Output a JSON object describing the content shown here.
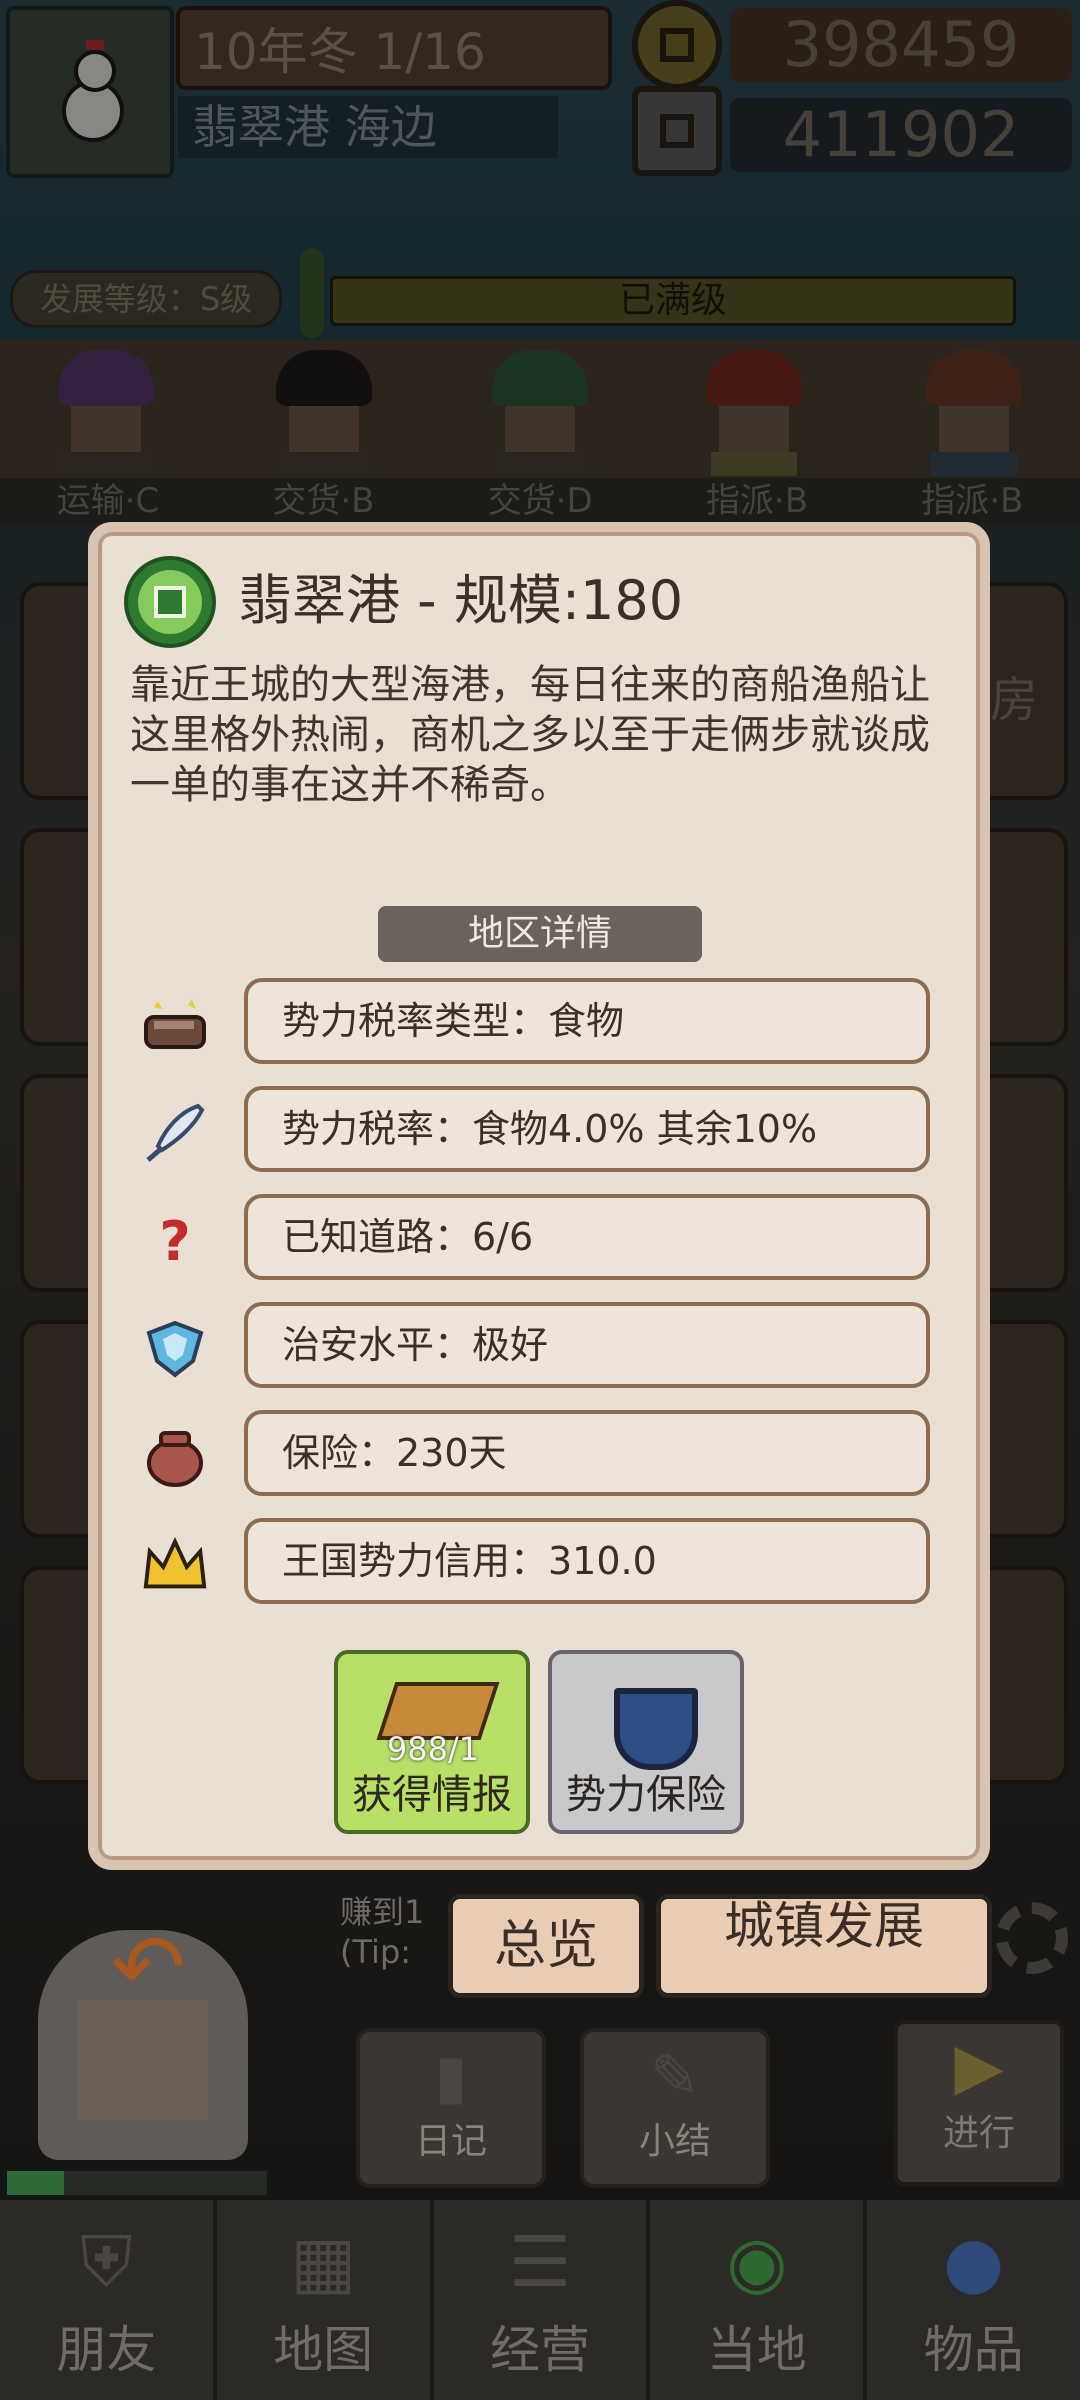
{
  "hud": {
    "date": "10年冬 1/16",
    "location": "翡翠港 海边",
    "gold": "398459",
    "silver": "411902"
  },
  "development": {
    "level_label": "发展等级：S级",
    "status": "已满级"
  },
  "staff_tags": [
    "运输·C",
    "交货·B",
    "交货·D",
    "指派·B",
    "指派·B"
  ],
  "side_text": "房",
  "dialog": {
    "title": "翡翠港 - 规模:180",
    "description": "靠近王城的大型海港，每日往来的商船渔船让这里格外热闹，商机之多以至于走俩步就谈成一单的事在这并不稀奇。",
    "section_label": "地区详情",
    "details": [
      {
        "icon": "bread-icon",
        "text": "势力税率类型：食物"
      },
      {
        "icon": "quill-icon",
        "text": "势力税率：食物4.0% 其余10%"
      },
      {
        "icon": "question-mark-icon",
        "text": "已知道路：6/6"
      },
      {
        "icon": "gem-shield-icon",
        "text": "治安水平：极好"
      },
      {
        "icon": "pot-icon",
        "text": "保险：230天"
      },
      {
        "icon": "crown-icon",
        "text": "王国势力信用：310.0"
      }
    ],
    "actions": {
      "intel_label": "获得情报",
      "intel_count": "988/1",
      "insurance_label": "势力保险"
    }
  },
  "bottom": {
    "earn_text": "赚到1",
    "tip_text": "(Tip:",
    "overview_label": "总览",
    "town_dev_label": "城镇发展",
    "diary_label": "日记",
    "summary_label": "小结",
    "proceed_label": "进行"
  },
  "tabs": [
    "朋友",
    "地图",
    "经营",
    "当地",
    "物品"
  ],
  "colors": {
    "dialog_bg": "#eadfd3",
    "intel_button": "#b8df66",
    "insurance_button": "#c9c8cb",
    "row_border": "#8b6b52"
  }
}
